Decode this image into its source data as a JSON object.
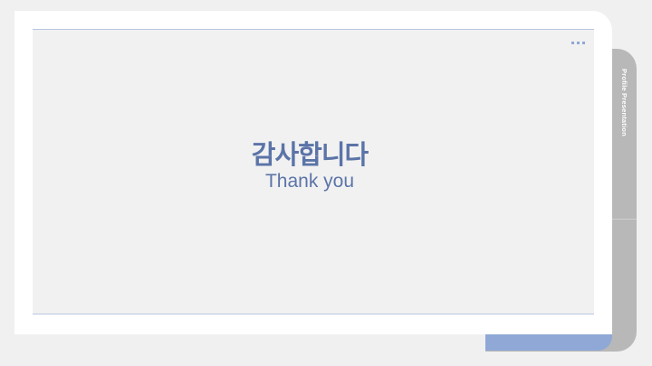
{
  "slide": {
    "title_ko": "감사합니다",
    "title_en": "Thank you"
  },
  "side_tab": {
    "label": "Profile Presentation"
  },
  "colors": {
    "accent": "#5b74a8",
    "accent_light": "#8fa8d6",
    "tab_gray": "#b8b8b8",
    "panel": "#f1f1f1"
  }
}
